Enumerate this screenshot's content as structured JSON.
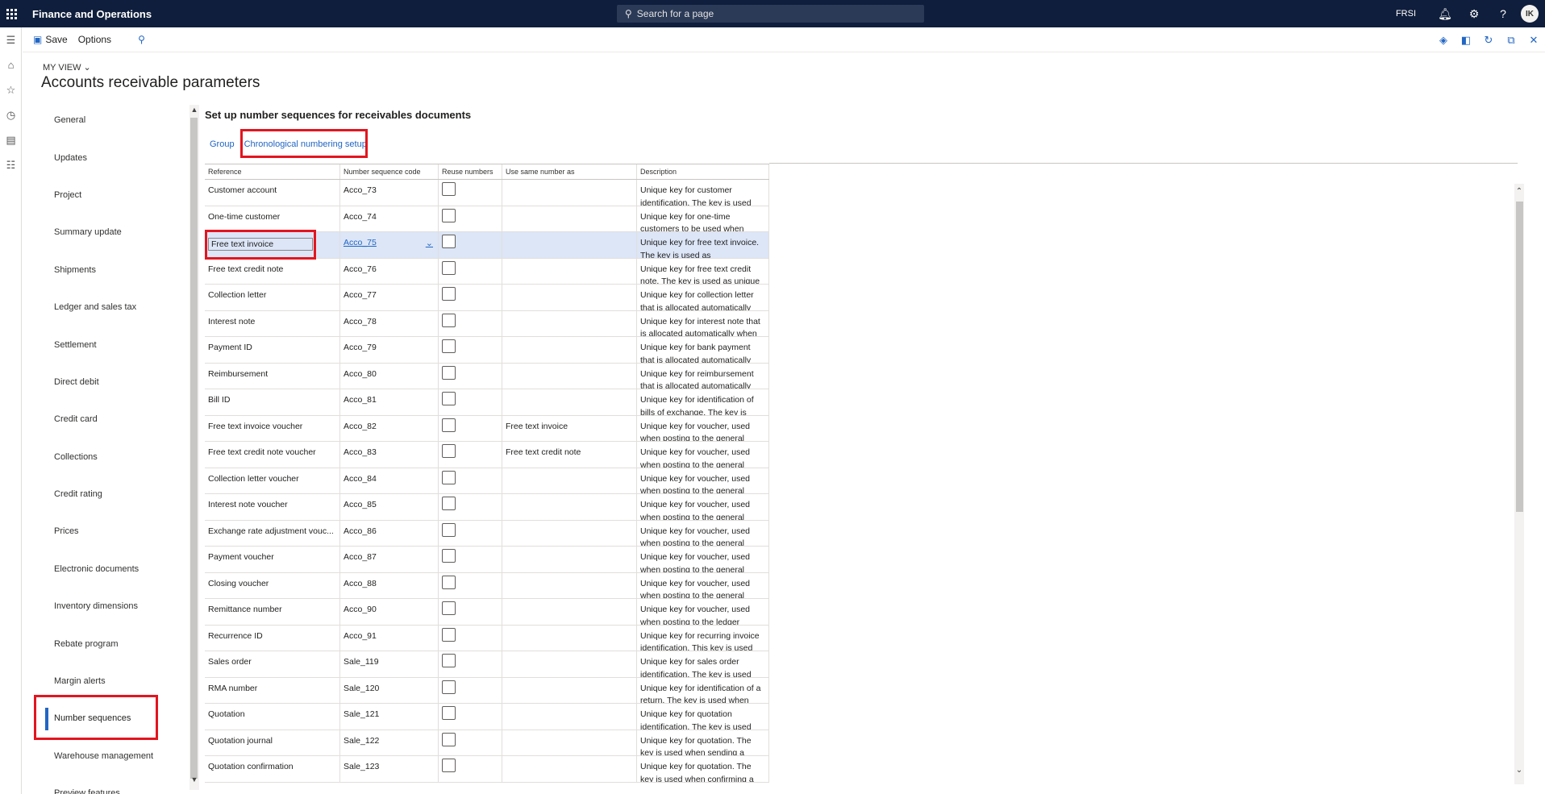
{
  "app": {
    "title": "Finance and Operations",
    "search_placeholder": "Search for a page",
    "legal_entity": "FRSI",
    "avatar_initials": "IK"
  },
  "actions": {
    "save": "Save",
    "options": "Options"
  },
  "header": {
    "view_label": "MY VIEW",
    "page_title": "Accounts receivable parameters"
  },
  "nav": {
    "items": [
      "General",
      "Updates",
      "Project",
      "Summary update",
      "Shipments",
      "Ledger and sales tax",
      "Settlement",
      "Direct debit",
      "Credit card",
      "Collections",
      "Credit rating",
      "Prices",
      "Electronic documents",
      "Inventory dimensions",
      "Rebate program",
      "Margin alerts",
      "Number sequences",
      "Warehouse management",
      "Preview features"
    ],
    "active": "Number sequences"
  },
  "section": {
    "title": "Set up number sequences for receivables documents",
    "tabs": [
      "Group",
      "Chronological numbering setup"
    ]
  },
  "grid": {
    "headers": [
      "Reference",
      "Number sequence code",
      "Reuse numbers",
      "Use same number as",
      "Description"
    ],
    "rows": [
      {
        "ref": "Customer account",
        "code": "Acco_73",
        "same": "",
        "desc": "Unique key for customer identification. The key is used"
      },
      {
        "ref": "One-time customer",
        "code": "Acco_74",
        "same": "",
        "desc": "Unique key for one-time customers to be used when"
      },
      {
        "ref": "Free text invoice",
        "code": "Acco_75",
        "same": "",
        "desc": "Unique key for free text invoice. The key is used as"
      },
      {
        "ref": "Free text credit note",
        "code": "Acco_76",
        "same": "",
        "desc": "Unique key for free text credit note. The key is used as unique"
      },
      {
        "ref": "Collection letter",
        "code": "Acco_77",
        "same": "",
        "desc": "Unique key for collection letter that is allocated automatically"
      },
      {
        "ref": "Interest note",
        "code": "Acco_78",
        "same": "",
        "desc": "Unique key for interest note that is allocated automatically when"
      },
      {
        "ref": "Payment ID",
        "code": "Acco_79",
        "same": "",
        "desc": "Unique key for bank payment that is allocated automatically"
      },
      {
        "ref": "Reimbursement",
        "code": "Acco_80",
        "same": "",
        "desc": "Unique key for reimbursement that is allocated automatically"
      },
      {
        "ref": "Bill ID",
        "code": "Acco_81",
        "same": "",
        "desc": "Unique key for identification of bills of exchange. The key is used"
      },
      {
        "ref": "Free text invoice voucher",
        "code": "Acco_82",
        "same": "Free text invoice",
        "desc": "Unique key for voucher, used when posting to the general"
      },
      {
        "ref": "Free text credit note voucher",
        "code": "Acco_83",
        "same": "Free text credit note",
        "desc": "Unique key for voucher, used when posting to the general"
      },
      {
        "ref": "Collection letter voucher",
        "code": "Acco_84",
        "same": "",
        "desc": "Unique key for voucher, used when posting to the general"
      },
      {
        "ref": "Interest note voucher",
        "code": "Acco_85",
        "same": "",
        "desc": "Unique key for voucher, used when posting to the general"
      },
      {
        "ref": "Exchange rate adjustment vouc...",
        "code": "Acco_86",
        "same": "",
        "desc": "Unique key for voucher, used when posting to the general"
      },
      {
        "ref": "Payment voucher",
        "code": "Acco_87",
        "same": "",
        "desc": "Unique key for voucher, used when posting to the general"
      },
      {
        "ref": "Closing voucher",
        "code": "Acco_88",
        "same": "",
        "desc": "Unique key for voucher, used when posting to the general"
      },
      {
        "ref": "Remittance number",
        "code": "Acco_90",
        "same": "",
        "desc": "Unique key for voucher, used when posting to the ledger"
      },
      {
        "ref": "Recurrence ID",
        "code": "Acco_91",
        "same": "",
        "desc": "Unique key for recurring invoice identification. This key is used"
      },
      {
        "ref": "Sales order",
        "code": "Sale_119",
        "same": "",
        "desc": "Unique key for sales order identification. The key is used"
      },
      {
        "ref": "RMA number",
        "code": "Sale_120",
        "same": "",
        "desc": "Unique key for identification of a return. The key is used when"
      },
      {
        "ref": "Quotation",
        "code": "Sale_121",
        "same": "",
        "desc": "Unique key for quotation identification. The key is used"
      },
      {
        "ref": "Quotation journal",
        "code": "Sale_122",
        "same": "",
        "desc": "Unique key for quotation. The key is used when sending a"
      },
      {
        "ref": "Quotation confirmation",
        "code": "Sale_123",
        "same": "",
        "desc": "Unique key for quotation. The key is used when confirming a"
      }
    ],
    "selected_index": 2
  },
  "colors": {
    "topbar": "#0f1e3c",
    "accent": "#2266c3",
    "highlight": "#e3151f",
    "selected_row": "#dce6f7"
  }
}
